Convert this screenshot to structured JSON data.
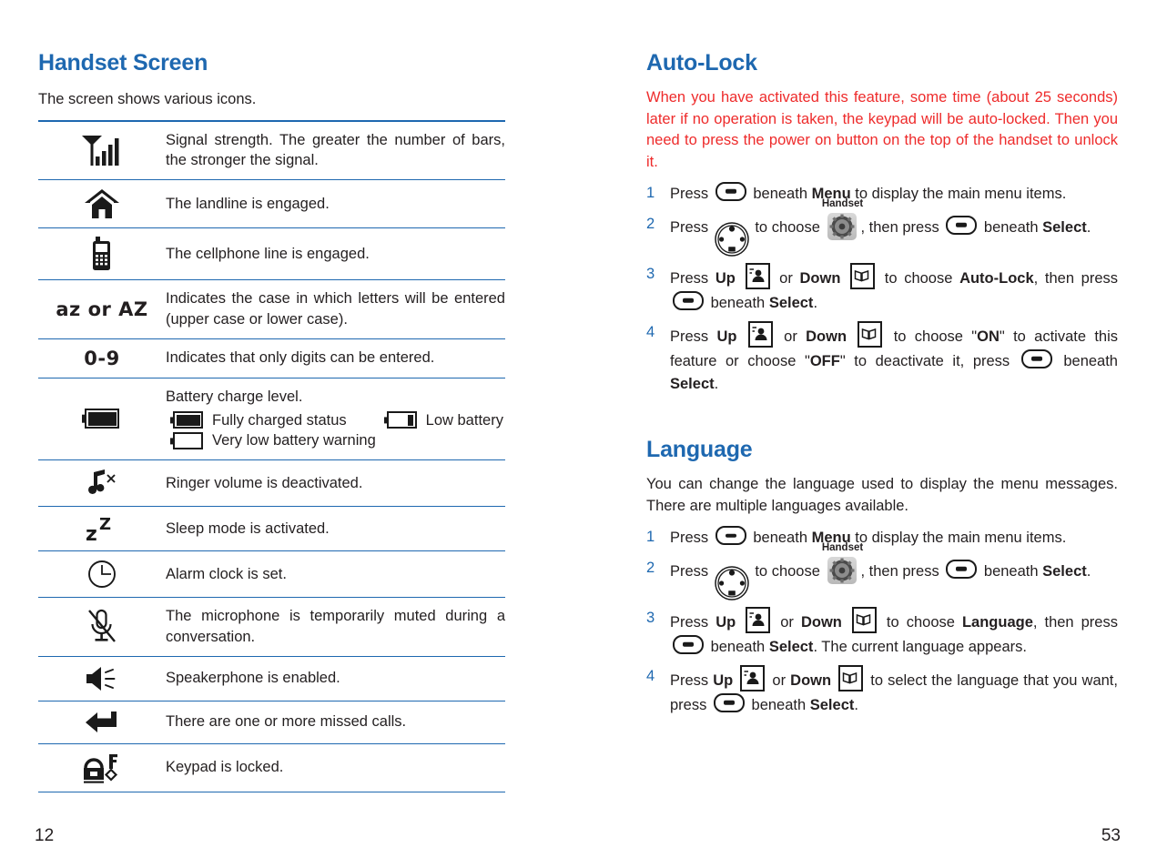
{
  "colors": {
    "heading_blue": "#1e68b0",
    "rule_blue": "#1e68b0",
    "warning_red": "#ee2b2b",
    "body_black": "#231f20"
  },
  "left_page": {
    "number": "12",
    "title": "Handset Screen",
    "intro": "The screen shows various icons.",
    "icon_table": {
      "rows": [
        {
          "icon": "signal-strength-icon",
          "icon_text": "",
          "description": "Signal strength. The greater the number of bars, the stronger the signal."
        },
        {
          "icon": "house-icon",
          "icon_text": "",
          "description": "The landline is engaged."
        },
        {
          "icon": "cellphone-icon",
          "icon_text": "",
          "description": "The cellphone line is engaged."
        },
        {
          "icon": "text-case-icon",
          "icon_text": "az or AZ",
          "description": "Indicates the case in which letters will be entered (upper case or lower case)."
        },
        {
          "icon": "digits-only-icon",
          "icon_text": "0-9",
          "description": "Indicates that only digits can be entered."
        },
        {
          "icon": "battery-icon",
          "icon_text": "",
          "description": "Battery charge level.",
          "battery_legend": {
            "full_label": "Fully charged status",
            "low_label": "Low battery",
            "very_low_label": "Very low battery warning"
          }
        },
        {
          "icon": "ringer-muted-icon",
          "icon_text": "",
          "description": "Ringer volume is deactivated."
        },
        {
          "icon": "sleep-mode-icon",
          "icon_text": "",
          "description": "Sleep mode is activated."
        },
        {
          "icon": "alarm-clock-icon",
          "icon_text": "",
          "description": "Alarm clock is set."
        },
        {
          "icon": "microphone-muted-icon",
          "icon_text": "",
          "description": "The microphone is temporarily muted during a conversation."
        },
        {
          "icon": "speakerphone-icon",
          "icon_text": "",
          "description": "Speakerphone is enabled."
        },
        {
          "icon": "missed-call-icon",
          "icon_text": "",
          "description": "There are one or more missed calls."
        },
        {
          "icon": "keypad-lock-icon",
          "icon_text": "",
          "description": "Keypad is locked."
        }
      ]
    }
  },
  "right_page": {
    "number": "53",
    "sections": [
      {
        "title": "Auto-Lock",
        "warning": "When you have activated this feature, some time (about 25 seconds) later if no operation is taken, the keypad will be auto-locked. Then you need to press the power on button on the top of the handset to unlock it.",
        "steps": [
          {
            "num": "1",
            "parts": [
              {
                "t": "text",
                "v": "Press "
              },
              {
                "t": "softkey"
              },
              {
                "t": "text",
                "v": " beneath "
              },
              {
                "t": "bold",
                "v": "Menu"
              },
              {
                "t": "text",
                "v": " to display the main menu items."
              }
            ]
          },
          {
            "num": "2",
            "parts": [
              {
                "t": "text",
                "v": "Press "
              },
              {
                "t": "navwheel"
              },
              {
                "t": "text",
                "v": " to choose "
              },
              {
                "t": "gear",
                "caption": "Handset"
              },
              {
                "t": "text",
                "v": ", then press "
              },
              {
                "t": "softkey"
              },
              {
                "t": "text",
                "v": " beneath "
              },
              {
                "t": "bold",
                "v": "Select"
              },
              {
                "t": "text",
                "v": "."
              }
            ]
          },
          {
            "num": "3",
            "parts": [
              {
                "t": "text",
                "v": "Press "
              },
              {
                "t": "bold",
                "v": "Up"
              },
              {
                "t": "text",
                "v": " "
              },
              {
                "t": "keyup"
              },
              {
                "t": "text",
                "v": " or "
              },
              {
                "t": "bold",
                "v": "Down"
              },
              {
                "t": "text",
                "v": " "
              },
              {
                "t": "keydown"
              },
              {
                "t": "text",
                "v": " to choose "
              },
              {
                "t": "bold",
                "v": "Auto-Lock"
              },
              {
                "t": "text",
                "v": ", then press "
              },
              {
                "t": "softkey"
              },
              {
                "t": "text",
                "v": " beneath "
              },
              {
                "t": "bold",
                "v": "Select"
              },
              {
                "t": "text",
                "v": "."
              }
            ]
          },
          {
            "num": "4",
            "parts": [
              {
                "t": "text",
                "v": "Press "
              },
              {
                "t": "bold",
                "v": "Up"
              },
              {
                "t": "text",
                "v": " "
              },
              {
                "t": "keyup"
              },
              {
                "t": "text",
                "v": " or "
              },
              {
                "t": "bold",
                "v": "Down"
              },
              {
                "t": "text",
                "v": " "
              },
              {
                "t": "keydown"
              },
              {
                "t": "text",
                "v": " to choose \""
              },
              {
                "t": "bold",
                "v": "ON"
              },
              {
                "t": "text",
                "v": "\" to activate this feature or choose \""
              },
              {
                "t": "bold",
                "v": "OFF"
              },
              {
                "t": "text",
                "v": "\" to deactivate it, press "
              },
              {
                "t": "softkey"
              },
              {
                "t": "text",
                "v": " beneath "
              },
              {
                "t": "bold",
                "v": "Select"
              },
              {
                "t": "text",
                "v": "."
              }
            ]
          }
        ]
      },
      {
        "title": "Language",
        "intro": "You can change the language used to display the menu messages. There are multiple languages available.",
        "steps": [
          {
            "num": "1",
            "parts": [
              {
                "t": "text",
                "v": "Press "
              },
              {
                "t": "softkey"
              },
              {
                "t": "text",
                "v": " beneath "
              },
              {
                "t": "bold",
                "v": "Menu"
              },
              {
                "t": "text",
                "v": " to display the main menu items."
              }
            ]
          },
          {
            "num": "2",
            "parts": [
              {
                "t": "text",
                "v": "Press "
              },
              {
                "t": "navwheel"
              },
              {
                "t": "text",
                "v": " to choose "
              },
              {
                "t": "gear",
                "caption": "Handset"
              },
              {
                "t": "text",
                "v": ", then press "
              },
              {
                "t": "softkey"
              },
              {
                "t": "text",
                "v": " beneath "
              },
              {
                "t": "bold",
                "v": "Select"
              },
              {
                "t": "text",
                "v": "."
              }
            ]
          },
          {
            "num": "3",
            "parts": [
              {
                "t": "text",
                "v": "Press "
              },
              {
                "t": "bold",
                "v": "Up"
              },
              {
                "t": "text",
                "v": " "
              },
              {
                "t": "keyup"
              },
              {
                "t": "text",
                "v": " or "
              },
              {
                "t": "bold",
                "v": "Down"
              },
              {
                "t": "text",
                "v": " "
              },
              {
                "t": "keydown"
              },
              {
                "t": "text",
                "v": " to choose "
              },
              {
                "t": "bold",
                "v": "Language"
              },
              {
                "t": "text",
                "v": ", then press "
              },
              {
                "t": "softkey"
              },
              {
                "t": "text",
                "v": " beneath "
              },
              {
                "t": "bold",
                "v": "Select"
              },
              {
                "t": "text",
                "v": ". The current language appears."
              }
            ]
          },
          {
            "num": "4",
            "parts": [
              {
                "t": "text",
                "v": "Press "
              },
              {
                "t": "bold",
                "v": "Up"
              },
              {
                "t": "text",
                "v": " "
              },
              {
                "t": "keyup"
              },
              {
                "t": "text",
                "v": " or "
              },
              {
                "t": "bold",
                "v": "Down"
              },
              {
                "t": "text",
                "v": " "
              },
              {
                "t": "keydown"
              },
              {
                "t": "text",
                "v": " to select the language that you want, press "
              },
              {
                "t": "softkey"
              },
              {
                "t": "text",
                "v": " beneath "
              },
              {
                "t": "bold",
                "v": "Select"
              },
              {
                "t": "text",
                "v": "."
              }
            ]
          }
        ]
      }
    ]
  }
}
